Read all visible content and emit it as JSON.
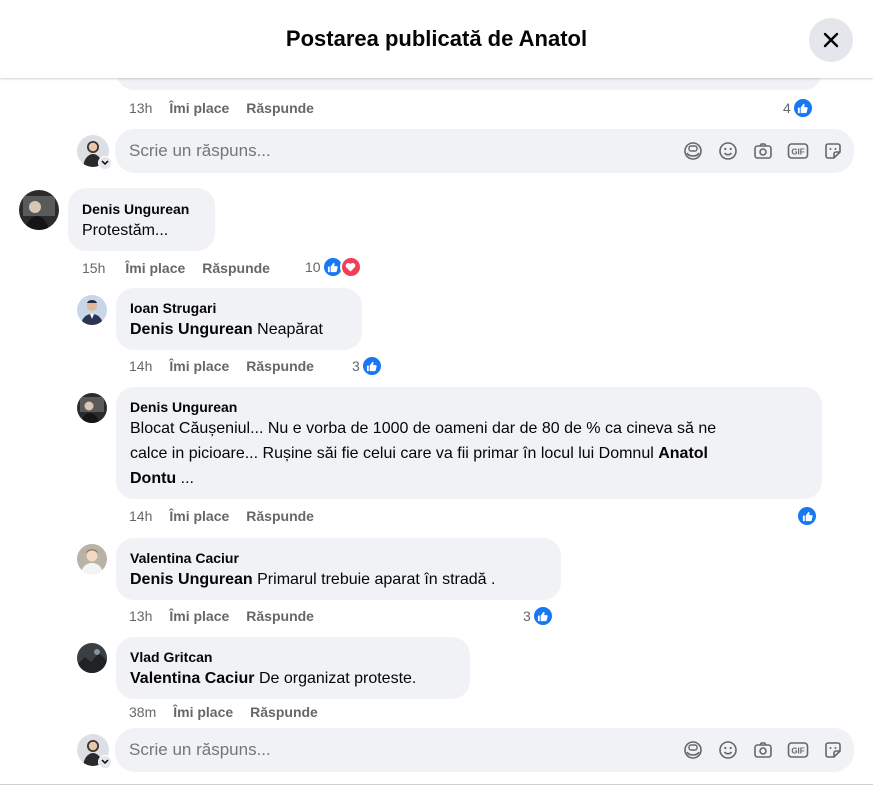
{
  "header": {
    "title": "Postarea publicată de Anatol"
  },
  "top_comment": {
    "time": "13h",
    "like": "Îmi place",
    "reply": "Răspunde",
    "reactions": "4"
  },
  "reply_box_1": {
    "placeholder": "Scrie un răspuns..."
  },
  "main_comment": {
    "author": "Denis Ungurean",
    "text": "Protestăm...",
    "time": "15h",
    "like": "Îmi place",
    "reply": "Răspunde",
    "reactions": "10"
  },
  "replies": [
    {
      "author": "Ioan Strugari",
      "mention": "Denis Ungurean",
      "text": " Neapărat",
      "time": "14h",
      "like": "Îmi place",
      "reply": "Răspunde",
      "reactions": "3"
    },
    {
      "author": "Denis Ungurean",
      "text_line1": "Blocat Căușeniul... Nu e vorba de 1000 de oameni dar de 80 de % ca cineva să ne",
      "text_line2a": "calce in picioare... Rușine săi fie celui care va fii primar în locul lui Domnul ",
      "mention_a": "Anatol",
      "mention_b": "Dontu",
      "text_line3": " ...",
      "time": "14h",
      "like": "Îmi place",
      "reply": "Răspunde"
    },
    {
      "author": "Valentina Caciur",
      "mention": "Denis Ungurean",
      "text": " Primarul trebuie aparat în stradă .",
      "time": "13h",
      "like": "Îmi place",
      "reply": "Răspunde",
      "reactions": "3"
    },
    {
      "author": "Vlad Gritcan",
      "mention": "Valentina Caciur",
      "text": " De organizat proteste.",
      "time": "38m",
      "like": "Îmi place",
      "reply": "Răspunde"
    }
  ],
  "reply_box_2": {
    "placeholder": "Scrie un răspuns..."
  },
  "colors": {
    "like": "#1877f2",
    "love": "#f33e58",
    "bubble": "#f0f2f5",
    "meta": "#65676b"
  },
  "icons": [
    "close-icon",
    "avatar-icon-sticker",
    "emoji-icon",
    "camera-icon",
    "gif-icon",
    "sticker-icon",
    "like-icon",
    "love-icon",
    "chevron-down-icon"
  ]
}
